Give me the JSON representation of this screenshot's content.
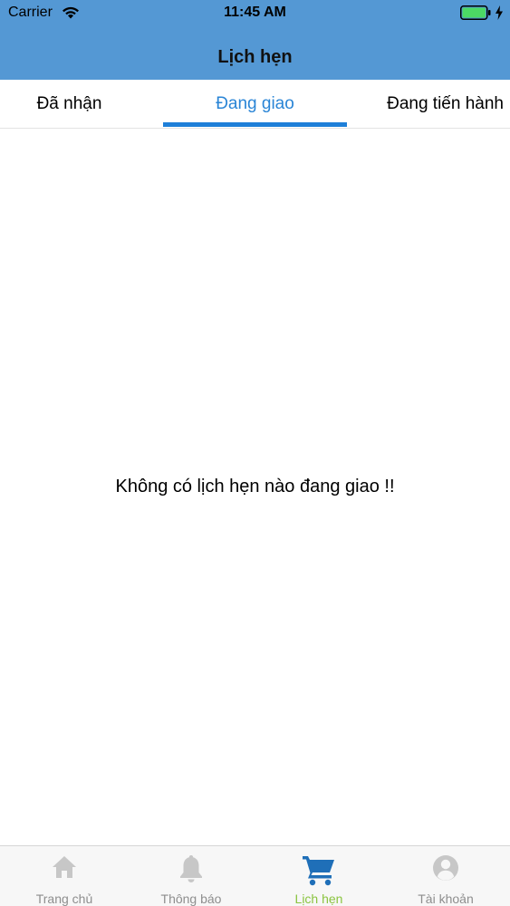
{
  "status_bar": {
    "carrier": "Carrier",
    "time": "11:45 AM"
  },
  "header": {
    "title": "Lịch hẹn"
  },
  "tabs": [
    {
      "label": "Đã nhận",
      "active": false
    },
    {
      "label": "Đang giao",
      "active": true
    },
    {
      "label": "Đang tiến hành",
      "active": false
    }
  ],
  "empty_state": {
    "message": "Không có lịch hẹn nào đang giao !!"
  },
  "tab_bar": {
    "items": [
      {
        "label": "Trang chủ",
        "icon": "home-icon",
        "active": false
      },
      {
        "label": "Thông báo",
        "icon": "bell-icon",
        "active": false
      },
      {
        "label": "Lịch hẹn",
        "icon": "cart-icon",
        "active": true
      },
      {
        "label": "Tài khoản",
        "icon": "account-icon",
        "active": false
      }
    ]
  },
  "colors": {
    "header_bg": "#5498d4",
    "active_tab": "#2a85d6",
    "tab_indicator": "#1e7fd8",
    "tabbar_active_label": "#8ac43f",
    "tabbar_active_icon": "#1f6fb8",
    "tabbar_inactive": "#c7c7c7",
    "battery_fill": "#4cd964"
  }
}
